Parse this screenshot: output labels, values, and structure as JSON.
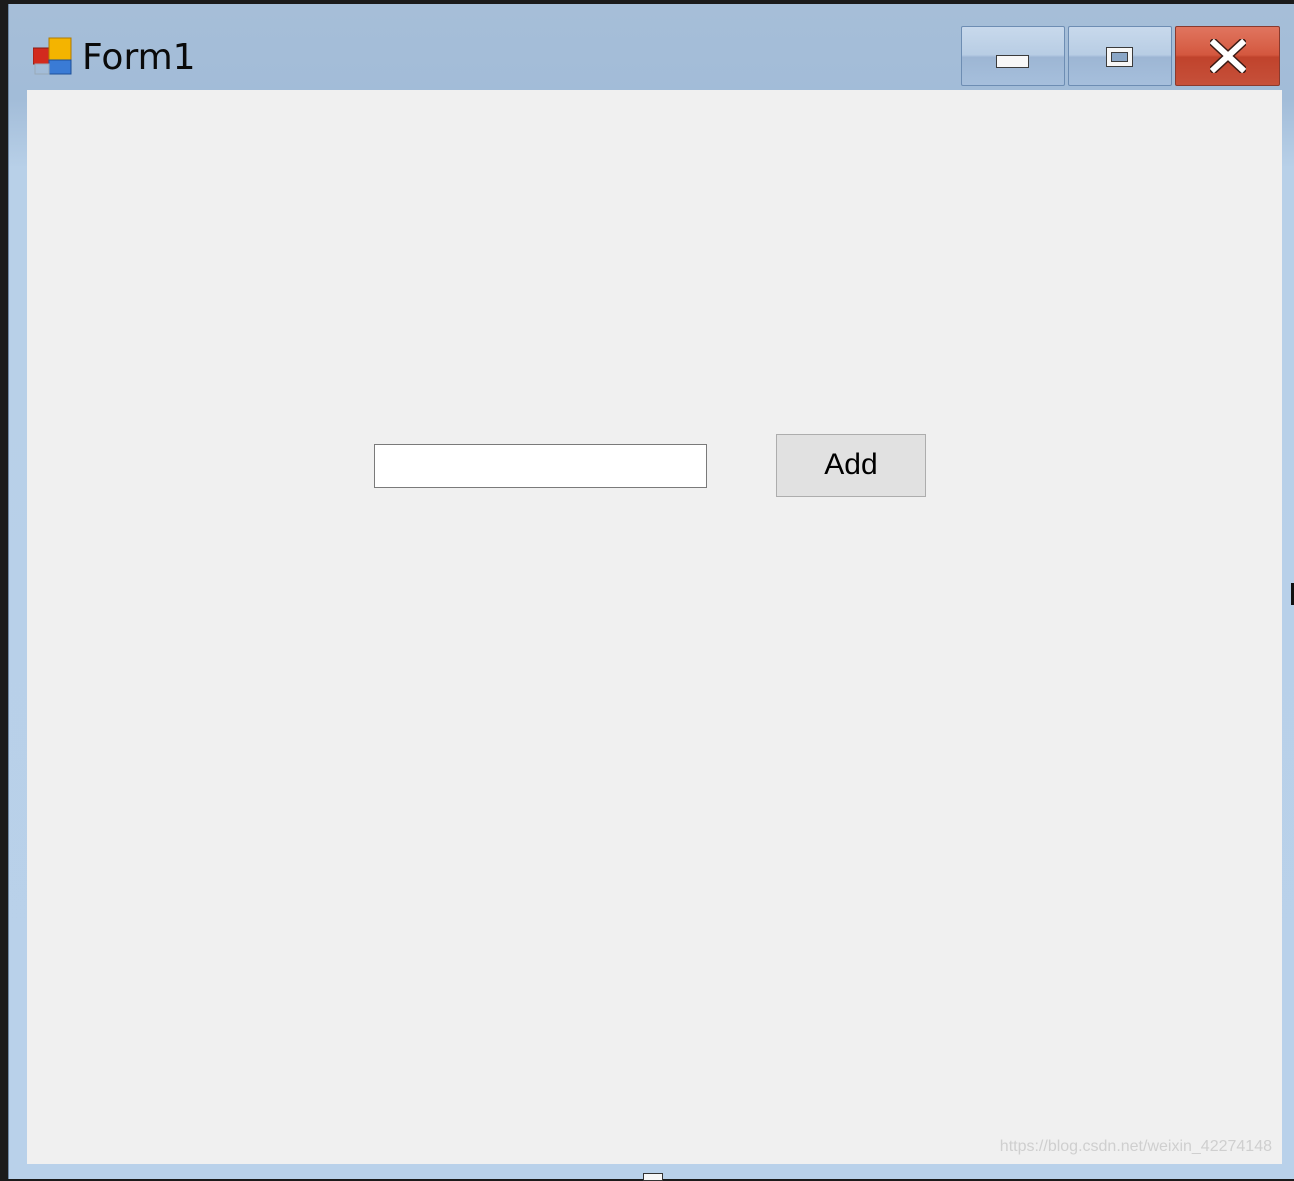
{
  "window": {
    "title": "Form1",
    "icon": "winforms-app-icon"
  },
  "caption_buttons": {
    "minimize": "minimize-icon",
    "maximize": "maximize-icon",
    "close": "close-icon"
  },
  "form": {
    "textbox_value": "",
    "add_button_label": "Add"
  },
  "watermark": "https://blog.csdn.net/weixin_42274148",
  "colors": {
    "titlebar": "#a2bcd8",
    "client_background": "#f0f0f0",
    "close_button": "#c8503a",
    "button_face": "#e1e1e1"
  }
}
